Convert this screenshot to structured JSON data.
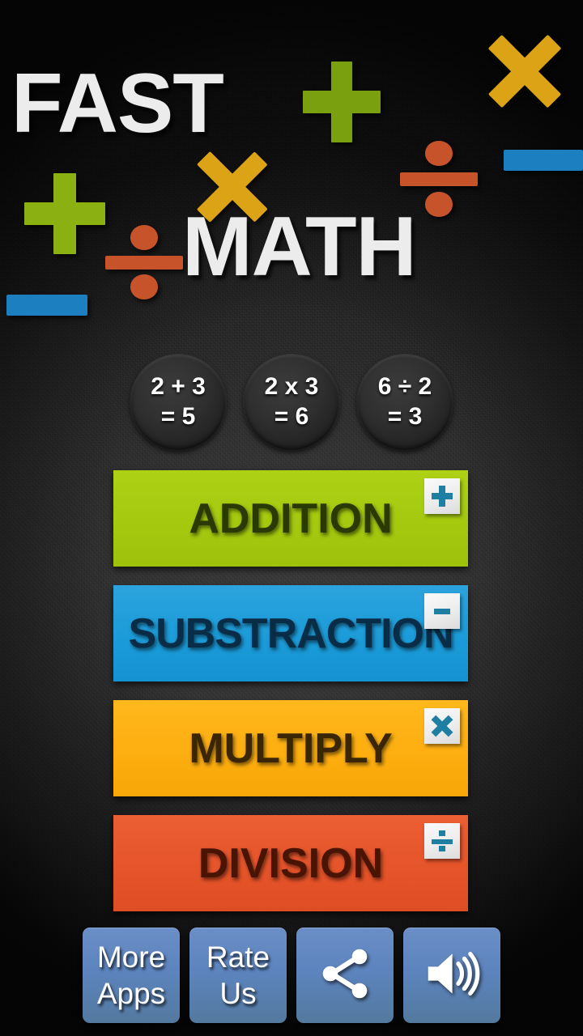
{
  "app": {
    "title_line1": "FAST",
    "title_line2": "MATH",
    "background_color": "#262626",
    "accent_colors": {
      "green": "#a4c90f",
      "blue": "#1b9cd9",
      "amber": "#fdae10",
      "orange_red": "#e6542a",
      "toolbar_blue": "#5d84be",
      "badge_teal": "#1f7fa3",
      "title_white": "#ececed"
    }
  },
  "decor": [
    {
      "name": "plus-green-top",
      "symbol": "+",
      "color": "#7ba00f"
    },
    {
      "name": "times-gold-top",
      "symbol": "x",
      "color": "#dda317"
    },
    {
      "name": "divide-red-top",
      "symbol": "/",
      "color": "#c7532a"
    },
    {
      "name": "dash-blue-top",
      "symbol": "-",
      "color": "#1b7fc0"
    },
    {
      "name": "plus-green-left",
      "symbol": "+",
      "color": "#8bb011"
    },
    {
      "name": "times-gold-mid",
      "symbol": "x",
      "color": "#dda317"
    },
    {
      "name": "divide-red-left",
      "symbol": "/",
      "color": "#c7532a"
    },
    {
      "name": "dash-blue-left",
      "symbol": "-",
      "color": "#1b7fc0"
    }
  ],
  "examples": [
    {
      "id": "addition-example",
      "top": "2 + 3",
      "bottom": "= 5"
    },
    {
      "id": "multiply-example",
      "top": "2 x 3",
      "bottom": "= 6"
    },
    {
      "id": "division-example",
      "top": "6 ÷ 2",
      "bottom": "= 3"
    }
  ],
  "operations": [
    {
      "id": "addition",
      "label": "ADDITION",
      "badge_icon": "plus-icon",
      "color": "#a4c90f"
    },
    {
      "id": "substraction",
      "label": "SUBSTRACTION",
      "badge_icon": "minus-icon",
      "color": "#1b9cd9"
    },
    {
      "id": "multiply",
      "label": "MULTIPLY",
      "badge_icon": "times-icon",
      "color": "#fdae10"
    },
    {
      "id": "division",
      "label": "DIVISION",
      "badge_icon": "divide-icon",
      "color": "#e6542a"
    }
  ],
  "toolbar": [
    {
      "id": "more-apps",
      "label_line1": "More",
      "label_line2": "Apps",
      "icon": null
    },
    {
      "id": "rate-us",
      "label_line1": "Rate",
      "label_line2": "Us",
      "icon": null
    },
    {
      "id": "share",
      "label_line1": "",
      "label_line2": "",
      "icon": "share-icon"
    },
    {
      "id": "sound",
      "label_line1": "",
      "label_line2": "",
      "icon": "speaker-icon"
    }
  ]
}
